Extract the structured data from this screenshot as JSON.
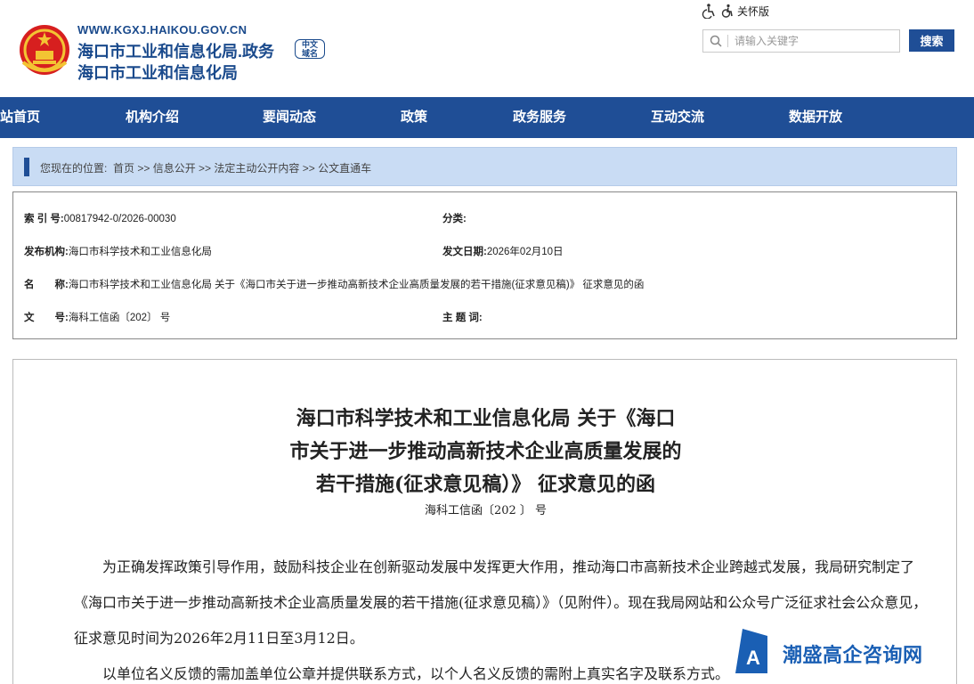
{
  "header": {
    "url": "WWW.KGXJ.HAIKOU.GOV.CN",
    "name_line1": "海口市工业和信息化局.政务",
    "name_tag": "中文域名",
    "name_line2": "海口市工业和信息化局"
  },
  "accessibility": {
    "label": "关怀版"
  },
  "search": {
    "placeholder": "请输入关键字",
    "button": "搜索"
  },
  "nav": [
    "站首页",
    "机构介绍",
    "要闻动态",
    "政策",
    "政务服务",
    "互动交流",
    "数据开放"
  ],
  "breadcrumb": {
    "prefix": "您现在的位置:",
    "path": "首页 >> 信息公开 >> 法定主动公开内容 >> 公文直通车"
  },
  "meta": {
    "index_label": "索 引 号:",
    "index_value": "00817942-0/2026-00030",
    "category_label": "分类:",
    "category_value": "",
    "publisher_label": "发布机构:",
    "publisher_value": "海口市科学技术和工业信息化局",
    "date_label": "发文日期:",
    "date_value": "2026年02月10日",
    "name_label": "名　　称:",
    "name_value": "海口市科学技术和工业信息化局 关于《海口市关于进一步推动高新技术企业高质量发展的若干措施(征求意见稿)》 征求意见的函",
    "docno_label": "文　　号:",
    "docno_value": "海科工信函〔202〕 号",
    "keywords_label": "主 题 词:",
    "keywords_value": ""
  },
  "document": {
    "title_line1": "海口市科学技术和工业信息化局 关于《海口",
    "title_line2": "市关于进一步推动高新技术企业高质量发展的",
    "title_line3": "若干措施(征求意见稿）》 征求意见的函",
    "doc_number": "海科工信函〔202 〕 号",
    "para1": "　　为正确发挥政策引导作用，鼓励科技企业在创新驱动发展中发挥更大作用，推动海口市高新技术企业跨越式发展，我局研究制定了《海口市关于进一步推动高新技术企业高质量发展的若干措施(征求意见稿）》（见附件）。现在我局网站和公众号广泛征求社会公众意见，征求意见时间为2026年2月11日至3月12日。",
    "para2": "　　以单位名义反馈的需加盖单位公章并提供联系方式，以个人名义反馈的需附上真实名字及联系方式。"
  },
  "watermark": {
    "text": "潮盛高企咨询网"
  },
  "colors": {
    "brand_blue": "#1f4e96",
    "crumb_bg": "#c9dcf4"
  }
}
